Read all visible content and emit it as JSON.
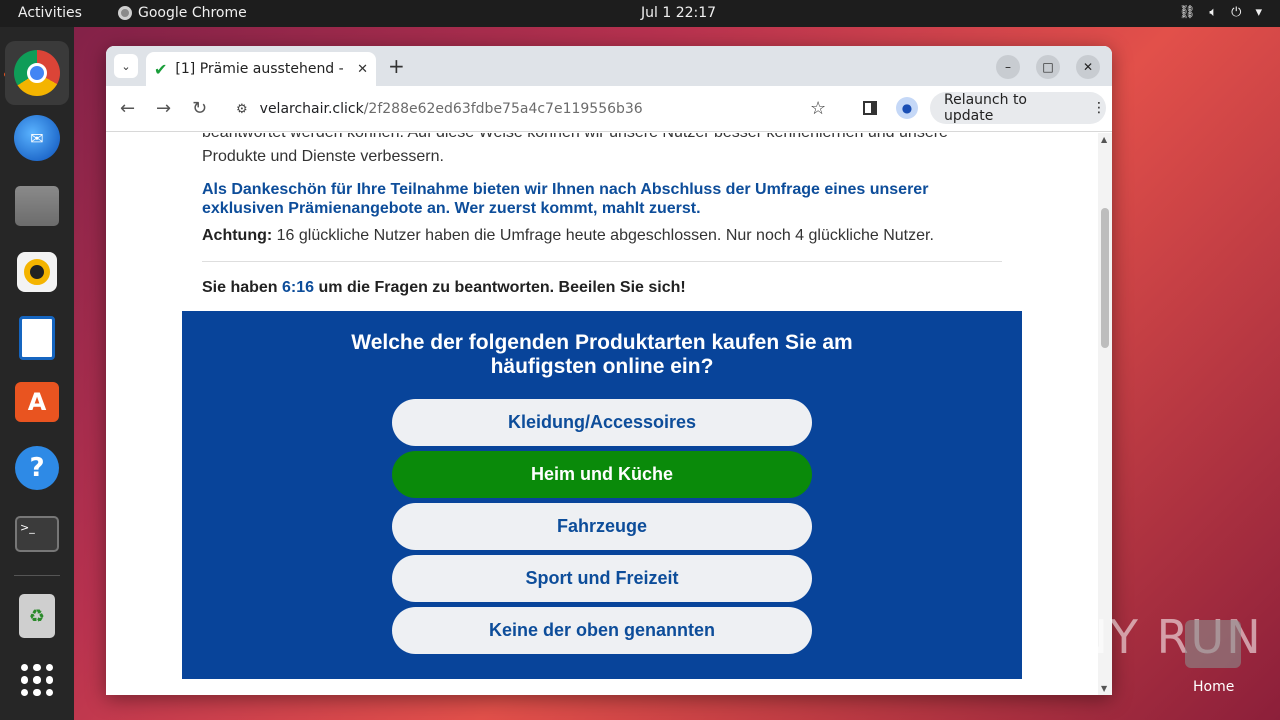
{
  "topbar": {
    "activities": "Activities",
    "app_name": "Google Chrome",
    "clock": "Jul 1  22:17"
  },
  "dock": {
    "items": [
      "chrome-icon",
      "thunderbird-icon",
      "files-icon",
      "rhythmbox-icon",
      "writer-icon",
      "app-center-icon",
      "help-icon",
      "terminal-icon",
      "trash-icon",
      "show-apps-icon"
    ]
  },
  "browser": {
    "tab_title": "[1] Prämie ausstehend - (",
    "url_domain": "velarchair.click",
    "url_path": "/2f288e62ed63fdbe75a4c7e119556b36",
    "relaunch_label": "Relaunch to update"
  },
  "page": {
    "cut_line": "beantwortet werden können. Auf diese Weise können wir unsere Nutzer besser kennenlernen und unsere",
    "line2": "Produkte und Dienste verbessern.",
    "offer": "Als Dankeschön für Ihre Teilnahme bieten wir Ihnen nach Abschluss der Umfrage eines unserer exklusiven Prämienangebote an. Wer zuerst kommt, mahlt zuerst.",
    "warning_label": "Achtung:",
    "warning_text": " 16 glückliche Nutzer haben die Umfrage heute abgeschlossen. Nur noch 4 glückliche Nutzer.",
    "timer_prefix": "Sie haben ",
    "timer_value": "6:16",
    "timer_suffix": " um die Fragen zu beantworten. Beeilen Sie sich!"
  },
  "quiz": {
    "question": "Welche der folgenden Produktarten kaufen Sie am häufigsten online ein?",
    "options": [
      "Kleidung/Accessoires",
      "Heim und Küche",
      "Fahrzeuge",
      "Sport und Freizeit",
      "Keine der oben genannten"
    ],
    "selected_index": 1
  },
  "overlay": {
    "watermark": "ANY RUN",
    "home_label": "Home"
  },
  "colors": {
    "accent_blue": "#08449a",
    "selected_green": "#0a8a0a"
  }
}
